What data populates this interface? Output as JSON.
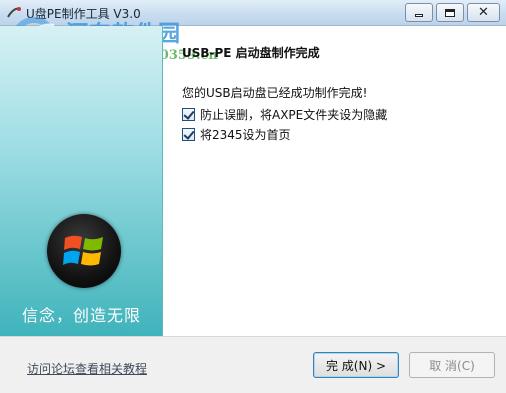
{
  "window": {
    "title": "U盘PE制作工具 V3.0",
    "watermark_site": "河东软件园",
    "watermark_url": "www.pc0359.cn"
  },
  "sidebar": {
    "slogan": "信念，创造无限"
  },
  "main": {
    "heading": "USB-PE 启动盘制作完成",
    "message": "您的USB启动盘已经成功制作完成!",
    "options": [
      {
        "label": "防止误删，将AXPE文件夹设为隐藏",
        "checked": true
      },
      {
        "label": "将2345设为首页",
        "checked": true
      }
    ]
  },
  "footer": {
    "help_link": "访问论坛查看相关教程",
    "finish_label": "完 成(N) >",
    "cancel_label": "取 消(C)"
  },
  "colors": {
    "sidebar_top": "#d6f1f3",
    "sidebar_bottom": "#3fb3bb",
    "titlebar": "#c9ddf0"
  }
}
